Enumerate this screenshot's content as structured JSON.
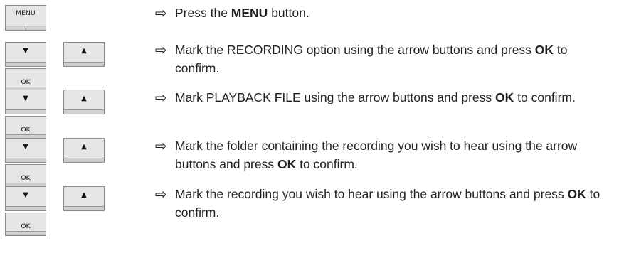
{
  "keys": {
    "menu": "MENU",
    "down": "▼",
    "up": "▲",
    "ok": "OK"
  },
  "bullet": "⇨",
  "steps": [
    {
      "pre": "Press the ",
      "b1": "MENU",
      "mid": " button.",
      "b2": "",
      "post": ""
    },
    {
      "pre": "Mark the RECORDING option using the arrow buttons and press ",
      "b1": "OK",
      "mid": " to confirm.",
      "b2": "",
      "post": ""
    },
    {
      "pre": "Mark PLAYBACK FILE using the arrow buttons and press ",
      "b1": "OK",
      "mid": " to confirm.",
      "b2": "",
      "post": ""
    },
    {
      "pre": "Mark the folder containing the recording you wish to hear using the arrow buttons and press ",
      "b1": "OK",
      "mid": " to confirm.",
      "b2": "",
      "post": ""
    },
    {
      "pre": "Mark the recording you wish to hear using the arrow buttons and press ",
      "b1": "OK",
      "mid": " to confirm.",
      "b2": "",
      "post": ""
    }
  ]
}
